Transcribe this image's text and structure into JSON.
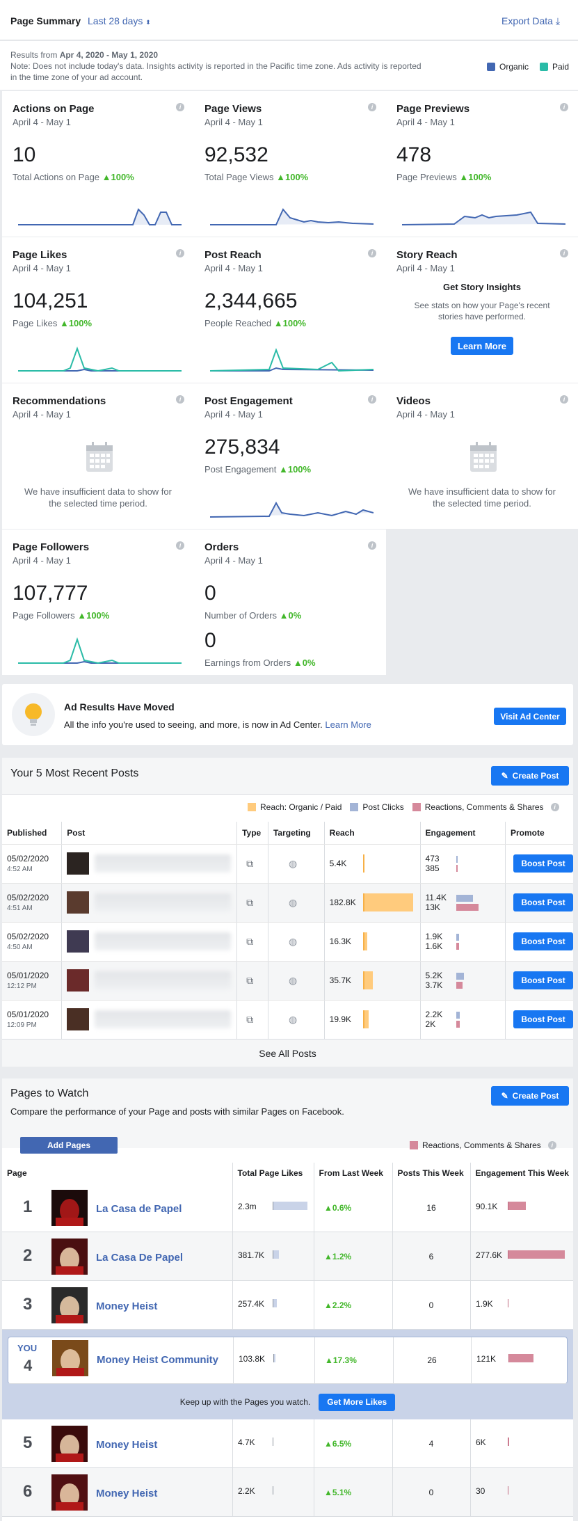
{
  "header": {
    "title": "Page Summary",
    "range": "Last 28 days",
    "range_icon": "caret-updown-icon",
    "export": "Export Data",
    "export_icon": "download-icon"
  },
  "notice": {
    "line1_prefix": "Results from ",
    "line1_bold": "Apr 4, 2020 - May 1, 2020",
    "line2": "Note: Does not include today's data. Insights activity is reported in the Pacific time zone. Ads activity is reported",
    "line3": "in the time zone of your ad account."
  },
  "legend": {
    "organic": "Organic",
    "paid": "Paid",
    "organic_color": "#4267b2",
    "paid_color": "#2abba7"
  },
  "cards": {
    "actions": {
      "title": "Actions on Page",
      "date": "April 4 - May 1",
      "value": "10",
      "label": "Total Actions on Page",
      "change": "▲100%"
    },
    "views": {
      "title": "Page Views",
      "date": "April 4 - May 1",
      "value": "92,532",
      "label": "Total Page Views",
      "change": "▲100%"
    },
    "previews": {
      "title": "Page Previews",
      "date": "April 4 - May 1",
      "value": "478",
      "label": "Page Previews",
      "change": "▲100%"
    },
    "likes": {
      "title": "Page Likes",
      "date": "April 4 - May 1",
      "value": "104,251",
      "label": "Page Likes",
      "change": "▲100%"
    },
    "reach": {
      "title": "Post Reach",
      "date": "April 4 - May 1",
      "value": "2,344,665",
      "label": "People Reached",
      "change": "▲100%"
    },
    "story": {
      "title": "Story Reach",
      "date": "April 4 - May 1",
      "heading": "Get Story Insights",
      "desc1": "See stats on how your Page's recent",
      "desc2": "stories have performed.",
      "button": "Learn More"
    },
    "recs": {
      "title": "Recommendations",
      "date": "April 4 - May 1",
      "msg1": "We have insufficient data to show for",
      "msg2": "the selected time period."
    },
    "engagement": {
      "title": "Post Engagement",
      "date": "April 4 - May 1",
      "value": "275,834",
      "label": "Post Engagement",
      "change": "▲100%"
    },
    "videos": {
      "title": "Videos",
      "date": "April 4 - May 1",
      "msg1": "We have insufficient data to show for",
      "msg2": "the selected time period."
    },
    "followers": {
      "title": "Page Followers",
      "date": "April 4 - May 1",
      "value": "107,777",
      "label": "Page Followers",
      "change": "▲100%"
    },
    "orders": {
      "title": "Orders",
      "date": "April 4 - May 1",
      "value": "0",
      "label": "Number of Orders",
      "change": "▲0%",
      "value2": "0",
      "label2": "Earnings from Orders",
      "change2": "▲0%"
    }
  },
  "ad_banner": {
    "title": "Ad Results Have Moved",
    "text": "All the info you're used to seeing, and more, is now in Ad Center. ",
    "link": "Learn More",
    "button": "Visit Ad Center",
    "icon": "lightbulb-icon"
  },
  "recent": {
    "title": "Your 5 Most Recent Posts",
    "create": "Create Post",
    "legend": [
      "Reach: Organic / Paid",
      "Post Clicks",
      "Reactions, Comments & Shares"
    ],
    "headers": [
      "Published",
      "Post",
      "Type",
      "Targeting",
      "Reach",
      "Engagement",
      "Promote"
    ],
    "rows": [
      {
        "date": "05/02/2020",
        "time": "4:52 AM",
        "reach": "5.4K",
        "e1": "473",
        "e2": "385",
        "reach_frac": 0.03,
        "e1_frac": 0.02,
        "e2_frac": 0.02,
        "boost": "Boost Post"
      },
      {
        "date": "05/02/2020",
        "time": "4:51 AM",
        "reach": "182.8K",
        "e1": "11.4K",
        "e2": "13K",
        "reach_frac": 1.0,
        "e1_frac": 0.85,
        "e2_frac": 1.0,
        "boost": "Boost Post"
      },
      {
        "date": "05/02/2020",
        "time": "4:50 AM",
        "reach": "16.3K",
        "e1": "1.9K",
        "e2": "1.6K",
        "reach_frac": 0.09,
        "e1_frac": 0.15,
        "e2_frac": 0.12,
        "boost": "Boost Post"
      },
      {
        "date": "05/01/2020",
        "time": "12:12 PM",
        "reach": "35.7K",
        "e1": "5.2K",
        "e2": "3.7K",
        "reach_frac": 0.2,
        "e1_frac": 0.4,
        "e2_frac": 0.28,
        "boost": "Boost Post"
      },
      {
        "date": "05/01/2020",
        "time": "12:09 PM",
        "reach": "19.9K",
        "e1": "2.2K",
        "e2": "2K",
        "reach_frac": 0.11,
        "e1_frac": 0.17,
        "e2_frac": 0.15,
        "boost": "Boost Post"
      }
    ],
    "see_all": "See All Posts"
  },
  "watch": {
    "title": "Pages to Watch",
    "subtitle": "Compare the performance of your Page and posts with similar Pages on Facebook.",
    "create": "Create Post",
    "add": "Add Pages",
    "legend": "Reactions, Comments & Shares",
    "headers": [
      "Page",
      "Total Page Likes",
      "From Last Week",
      "Posts This Week",
      "Engagement This Week"
    ],
    "rows": [
      {
        "rank": "1",
        "name": "La Casa de Papel",
        "likes": "2.3m",
        "likes_frac": 1.0,
        "change": "▲0.6%",
        "posts": "16",
        "eng": "90.1K",
        "eng_frac": 0.32
      },
      {
        "rank": "2",
        "name": "La Casa De Papel",
        "likes": "381.7K",
        "likes_frac": 0.17,
        "change": "▲1.2%",
        "posts": "6",
        "eng": "277.6K",
        "eng_frac": 1.0
      },
      {
        "rank": "3",
        "name": "Money Heist",
        "likes": "257.4K",
        "likes_frac": 0.11,
        "change": "▲2.2%",
        "posts": "0",
        "eng": "1.9K",
        "eng_frac": 0.01
      },
      {
        "rank": "4",
        "you": "YOU",
        "name": "Money Heist Community",
        "likes": "103.8K",
        "likes_frac": 0.05,
        "change": "▲17.3%",
        "posts": "26",
        "eng": "121K",
        "eng_frac": 0.44
      },
      {
        "rank": "5",
        "name": "Money Heist",
        "likes": "4.7K",
        "likes_frac": 0.002,
        "change": "▲6.5%",
        "posts": "4",
        "eng": "6K",
        "eng_frac": 0.02
      },
      {
        "rank": "6",
        "name": "Money Heist",
        "likes": "2.2K",
        "likes_frac": 0.001,
        "change": "▲5.1%",
        "posts": "0",
        "eng": "30",
        "eng_frac": 0.001
      }
    ],
    "keep": "Keep up with the Pages you watch.",
    "more": "Get More Likes"
  }
}
